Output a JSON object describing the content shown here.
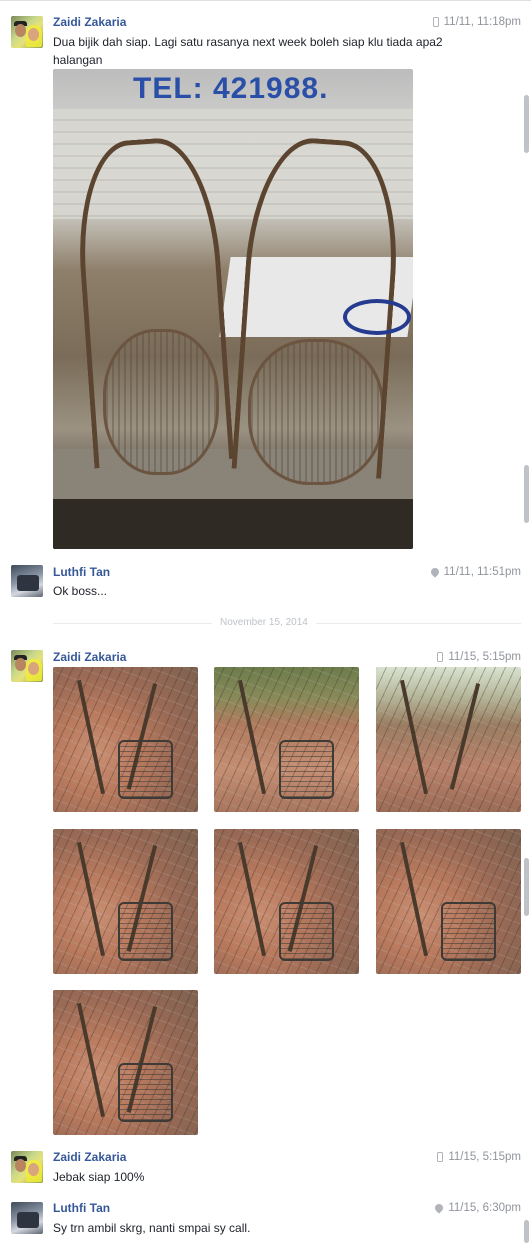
{
  "date_divider": "November 15, 2014",
  "messages": [
    {
      "author": "Zaidi Zakaria",
      "time": "11/11, 11:18pm",
      "source_icon": "mobile-icon",
      "text": "Dua bijik dah siap. Lagi satu rasanya next week boleh siap klu tiada apa2 halangan",
      "photo_sign": "TEL: 421988."
    },
    {
      "author": "Luthfi Tan",
      "time": "11/11, 11:51pm",
      "source_icon": "location-pin-icon",
      "text": "Ok boss..."
    },
    {
      "author": "Zaidi Zakaria",
      "time": "11/15, 5:15pm",
      "source_icon": "mobile-icon",
      "photo_count": 7
    },
    {
      "author": "Zaidi Zakaria",
      "time": "11/15, 5:15pm",
      "source_icon": "mobile-icon",
      "text": "Jebak siap 100%"
    },
    {
      "author": "Luthfi Tan",
      "time": "11/15, 6:30pm",
      "source_icon": "location-pin-icon",
      "text": "Sy trn ambil skrg, nanti smpai sy call."
    }
  ],
  "colors": {
    "author_link": "#365899",
    "meta_text": "#90949c",
    "body_text": "#1d2129"
  }
}
